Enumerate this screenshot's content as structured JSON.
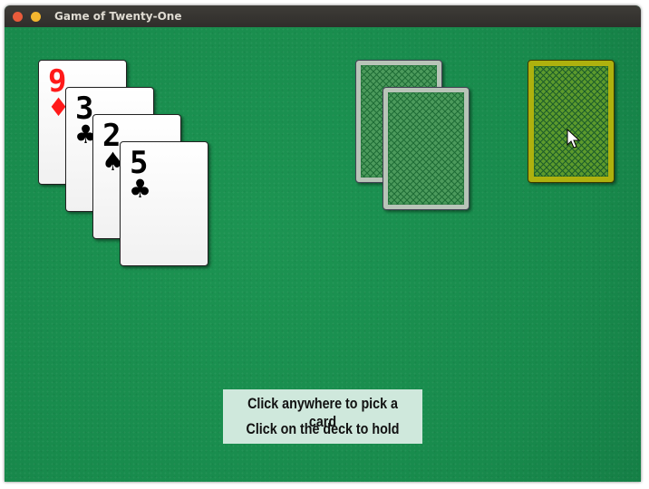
{
  "window": {
    "title": "Game of Twenty-One"
  },
  "player_hand": [
    {
      "rank": "9",
      "suit": "♦",
      "suit_name": "diamonds",
      "color": "#ff1a1a"
    },
    {
      "rank": "3",
      "suit": "♣",
      "suit_name": "clubs",
      "color": "#000000"
    },
    {
      "rank": "2",
      "suit": "♠",
      "suit_name": "spades",
      "color": "#000000"
    },
    {
      "rank": "5",
      "suit": "♣",
      "suit_name": "clubs",
      "color": "#000000"
    }
  ],
  "dealer_hand": {
    "face_down_cards": 2,
    "back_color": "#b8c4b8",
    "pattern_color": "#2e8a48"
  },
  "deck": {
    "back_color": "#aeb10e",
    "pattern_color": "#1f8040"
  },
  "message": {
    "line1": "Click anywhere to pick a card",
    "line2": "Click on the deck to hold"
  },
  "colors": {
    "felt": "#1a8a4f",
    "message_bg": "#cfe8dc"
  }
}
